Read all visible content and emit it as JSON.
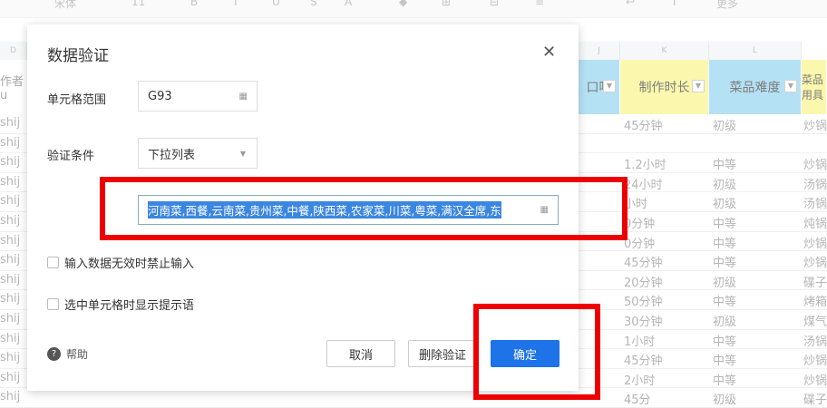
{
  "toolbar": {
    "items": [
      "宋体",
      "11",
      "B",
      "I",
      "U",
      "S",
      "A",
      "◆",
      "⊞",
      "⊟",
      "≡",
      "↩",
      "T",
      "更多"
    ]
  },
  "sheet": {
    "col_letters": [
      "D",
      "J",
      "K",
      "L"
    ],
    "left_header": "作者u",
    "left_cell": "shij",
    "headers": [
      {
        "label": "口味",
        "color": "#a9dcf3"
      },
      {
        "label": "制作时长",
        "color": "#fbf7a0"
      },
      {
        "label": "菜品难度",
        "color": "#a9dcf3"
      },
      {
        "label": "菜品用具",
        "color": "#fbf7a0"
      }
    ],
    "rows": [
      [
        "45分钟",
        "初级",
        "炒锅"
      ],
      [
        "",
        "",
        ""
      ],
      [
        "1.2小时",
        "中等",
        "炒锅"
      ],
      [
        "24小时",
        "初级",
        "汤锅"
      ],
      [
        "小时",
        "初级",
        "汤锅"
      ],
      [
        "0分钟",
        "中等",
        "炖锅"
      ],
      [
        "0分钟",
        "中等",
        "炒锅"
      ],
      [
        "45分钟",
        "中等",
        "炒锅"
      ],
      [
        "20分钟",
        "初级",
        "碟子"
      ],
      [
        "50分钟",
        "中等",
        "烤箱"
      ],
      [
        "30分钟",
        "初级",
        "煤气"
      ],
      [
        "1小时",
        "中等",
        "汤锅"
      ],
      [
        "45分钟",
        "中等",
        "炒锅"
      ],
      [
        "2小时",
        "中等",
        "炒锅"
      ],
      [
        "45分",
        "初级",
        "碟子"
      ]
    ]
  },
  "dialog": {
    "title": "数据验证",
    "range_label": "单元格范围",
    "range_value": "G93",
    "criteria_label": "验证条件",
    "criteria_value": "下拉列表",
    "list_value": "河南菜,西餐,云南菜,贵州菜,中餐,陕西菜,农家菜,川菜,粤菜,满汉全席,东",
    "reject_label": "输入数据无效时禁止输入",
    "hint_label": "选中单元格时显示提示语",
    "help_label": "帮助",
    "cancel_label": "取消",
    "remove_label": "删除验证",
    "ok_label": "确定"
  },
  "colors": {
    "accent": "#1e73e8",
    "highlight": "#e00000"
  }
}
